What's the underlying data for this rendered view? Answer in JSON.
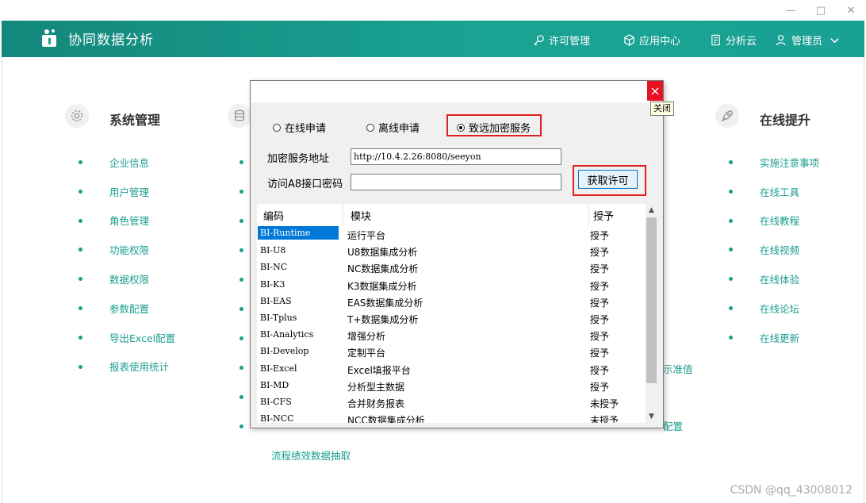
{
  "window": {
    "minimize": "—",
    "maximize": "□",
    "close": "✕"
  },
  "header": {
    "title": "协同数据分析",
    "nav": [
      {
        "label": "许可管理",
        "icon": "key-icon"
      },
      {
        "label": "应用中心",
        "icon": "cube-icon"
      },
      {
        "label": "分析云",
        "icon": "document-icon"
      },
      {
        "label": "管理员",
        "icon": "user-icon"
      }
    ],
    "brand_color": "#1a9e8f"
  },
  "sections": {
    "system": {
      "title": "系统管理",
      "icon": "gear-icon",
      "items": [
        "企业信息",
        "用户管理",
        "角色管理",
        "功能权限",
        "数据权限",
        "参数配置",
        "导出Excel配置",
        "报表使用统计"
      ]
    },
    "data": {
      "icon": "database-icon",
      "items_visible": [
        "流程绩效数据抽取"
      ]
    },
    "online": {
      "title": "在线提升",
      "icon": "rocket-icon",
      "items": [
        "实施注意事项",
        "在线工具",
        "在线教程",
        "在线视频",
        "在线体验",
        "在线论坛",
        "在线更新"
      ]
    },
    "partial_texts": [
      "示准值",
      "配置"
    ]
  },
  "dialog": {
    "close_tooltip": "关闭",
    "radios": [
      {
        "label": "在线申请",
        "selected": false
      },
      {
        "label": "离线申请",
        "selected": false
      },
      {
        "label": "致远加密服务",
        "selected": true
      }
    ],
    "server_label": "加密服务地址",
    "server_value": "http://10.4.2.26:8080/seeyon",
    "password_label": "访问A8接口密码",
    "password_value": "",
    "get_license_button": "获取许可",
    "columns": [
      "编码",
      "模块",
      "授予"
    ],
    "rows": [
      {
        "code": "BI-Runtime",
        "module": "运行平台",
        "auth": "授予"
      },
      {
        "code": "BI-U8",
        "module": "U8数据集成分析",
        "auth": "授予"
      },
      {
        "code": "BI-NC",
        "module": "NC数据集成分析",
        "auth": "授予"
      },
      {
        "code": "BI-K3",
        "module": "K3数据集成分析",
        "auth": "授予"
      },
      {
        "code": "BI-EAS",
        "module": "EAS数据集成分析",
        "auth": "授予"
      },
      {
        "code": "BI-Tplus",
        "module": "T+数据集成分析",
        "auth": "授予"
      },
      {
        "code": "BI-Analytics",
        "module": "增强分析",
        "auth": "授予"
      },
      {
        "code": "BI-Develop",
        "module": "定制平台",
        "auth": "授予"
      },
      {
        "code": "BI-Excel",
        "module": "Excel填报平台",
        "auth": "授予"
      },
      {
        "code": "BI-MD",
        "module": "分析型主数据",
        "auth": "授予"
      },
      {
        "code": "BI-CFS",
        "module": "合并财务报表",
        "auth": "未授予"
      },
      {
        "code": "BI-NCC",
        "module": "NCC数据集成分析",
        "auth": "未授予"
      }
    ]
  },
  "watermark": "CSDN @qq_43008012"
}
